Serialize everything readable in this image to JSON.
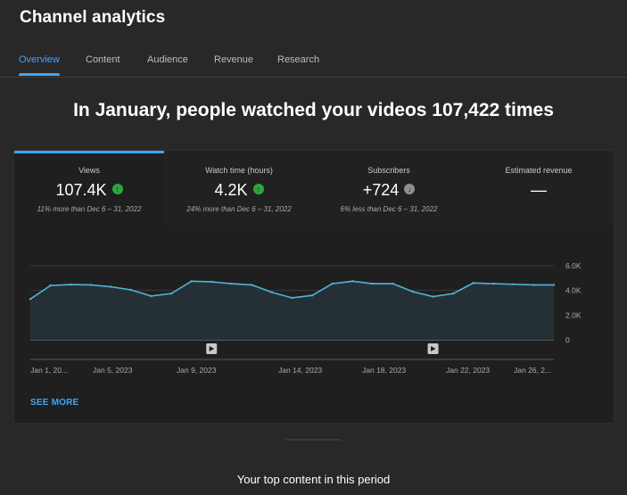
{
  "page": {
    "title": "Channel analytics"
  },
  "tabs": [
    {
      "label": "Overview",
      "active": true
    },
    {
      "label": "Content",
      "active": false
    },
    {
      "label": "Audience",
      "active": false
    },
    {
      "label": "Revenue",
      "active": false
    },
    {
      "label": "Research",
      "active": false
    }
  ],
  "headline": "In January, people watched your videos 107,422 times",
  "metrics": [
    {
      "label": "Views",
      "value": "107.4K",
      "trend": "up",
      "compare": "11% more than Dec 6 – 31, 2022",
      "selected": true
    },
    {
      "label": "Watch time (hours)",
      "value": "4.2K",
      "trend": "up",
      "compare": "24% more than Dec 6 – 31, 2022",
      "selected": false
    },
    {
      "label": "Subscribers",
      "value": "+724",
      "trend": "down",
      "compare": "6% less than Dec 6 – 31, 2022",
      "selected": false
    },
    {
      "label": "Estimated revenue",
      "value": "—",
      "trend": "none",
      "compare": "",
      "selected": false
    }
  ],
  "chart_data": {
    "type": "area",
    "x_tick_labels": [
      "Jan 1, 20...",
      "Jan 5, 2023",
      "Jan 9, 2023",
      "Jan 14, 2023",
      "Jan 18, 2023",
      "Jan 22, 2023",
      "Jan 26, 2..."
    ],
    "y_tick_labels": [
      "6.0K",
      "4.0K",
      "2.0K",
      "0"
    ],
    "ylim": [
      0,
      6000
    ],
    "grid": true,
    "series": [
      {
        "values": [
          3300,
          4400,
          4480,
          4450,
          4300,
          4050,
          3550,
          3750,
          4750,
          4700,
          4550,
          4450,
          3850,
          3400,
          3600,
          4550,
          4750,
          4550,
          4550,
          3900,
          3500,
          3750,
          4600,
          4550,
          4500,
          4450,
          4450
        ],
        "color": "#4fb3d9"
      }
    ],
    "video_markers": [
      {
        "index": 9
      },
      {
        "index": 20
      }
    ]
  },
  "see_more_label": "SEE MORE",
  "top_content_title": "Your top content in this period",
  "colors": {
    "accent": "#3ea6ff",
    "up": "#2ba640",
    "down": "#8f8f8f",
    "line": "#4fb3d9"
  }
}
